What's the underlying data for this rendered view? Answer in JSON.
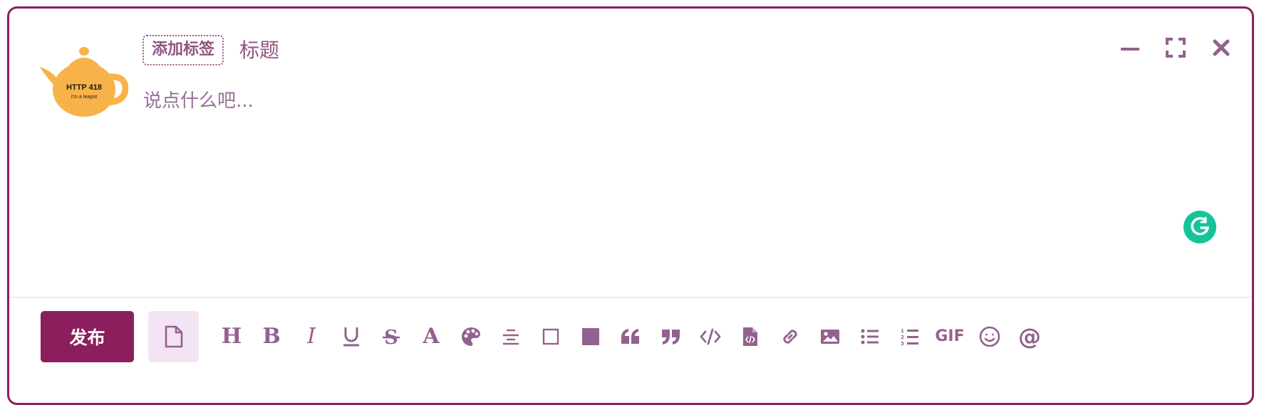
{
  "composer": {
    "avatar": {
      "line1": "HTTP 418",
      "line2": "I'm a teapot"
    },
    "tag_button_label": "添加标签",
    "title_placeholder": "标题",
    "body_placeholder": "说点什么吧...",
    "window_controls": [
      "minimize-icon",
      "fullscreen-icon",
      "close-icon"
    ]
  },
  "toolbar": {
    "publish_label": "发布",
    "tools": [
      "heading-icon",
      "bold-icon",
      "italic-icon",
      "underline-icon",
      "strikethrough-icon",
      "font-color-icon",
      "palette-icon",
      "align-center-icon",
      "checkbox-icon",
      "filled-square-icon",
      "quote-open-icon",
      "quote-close-icon",
      "code-icon",
      "code-file-icon",
      "link-icon",
      "image-icon",
      "bullet-list-icon",
      "numbered-list-icon",
      "gif-icon",
      "emoji-icon",
      "mention-icon"
    ],
    "gif_label": "GIF"
  },
  "colors": {
    "brand": "#8b1f5e",
    "icon": "#93618f",
    "draft_bg": "#f3e4f3",
    "grammarly": "#15c39a"
  }
}
